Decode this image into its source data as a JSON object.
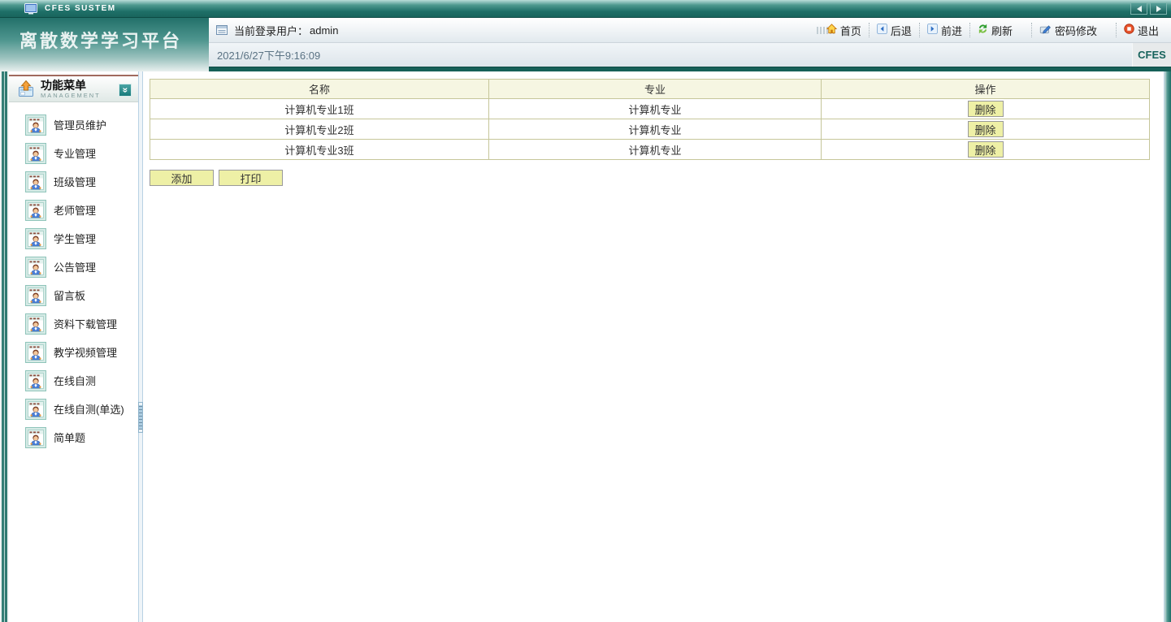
{
  "window": {
    "title": "CFES SUSTEM"
  },
  "banner": {
    "logo_title": "离散数学学习平台",
    "user_label": "当前登录用户：",
    "user_name": "admin",
    "datetime": "2021/6/27下午9:16:09",
    "brand": "CFES"
  },
  "nav": {
    "items": [
      {
        "label": "首页",
        "icon": "home-icon"
      },
      {
        "label": "后退",
        "icon": "back-icon"
      },
      {
        "label": "前进",
        "icon": "forward-icon"
      },
      {
        "label": "刷新",
        "icon": "refresh-icon"
      },
      {
        "label": "密码修改",
        "icon": "password-edit-icon"
      },
      {
        "label": "退出",
        "icon": "logout-icon"
      }
    ]
  },
  "sidebar": {
    "title": "功能菜单",
    "subtitle": "MANAGEMENT",
    "items": [
      {
        "label": "管理员维护"
      },
      {
        "label": "专业管理"
      },
      {
        "label": "班级管理"
      },
      {
        "label": "老师管理"
      },
      {
        "label": "学生管理"
      },
      {
        "label": "公告管理"
      },
      {
        "label": "留言板"
      },
      {
        "label": "资料下载管理"
      },
      {
        "label": "教学视频管理"
      },
      {
        "label": "在线自测"
      },
      {
        "label": "在线自测(单选)"
      },
      {
        "label": "简单题"
      }
    ]
  },
  "classTable": {
    "headers": [
      "名称",
      "专业",
      "操作"
    ],
    "rows": [
      {
        "name": "计算机专业1班",
        "major": "计算机专业",
        "action": "删除"
      },
      {
        "name": "计算机专业2班",
        "major": "计算机专业",
        "action": "删除"
      },
      {
        "name": "计算机专业3班",
        "major": "计算机专业",
        "action": "删除"
      }
    ]
  },
  "actions": {
    "add": "添加",
    "print": "打印"
  },
  "colors": {
    "titlebar_teal": "#1e6f67",
    "accent_bar": "#166058",
    "table_border": "#c6c69a",
    "table_header_bg": "#f6f6e2",
    "button_bg": "#eef0a6",
    "brand_text": "#17635c"
  }
}
